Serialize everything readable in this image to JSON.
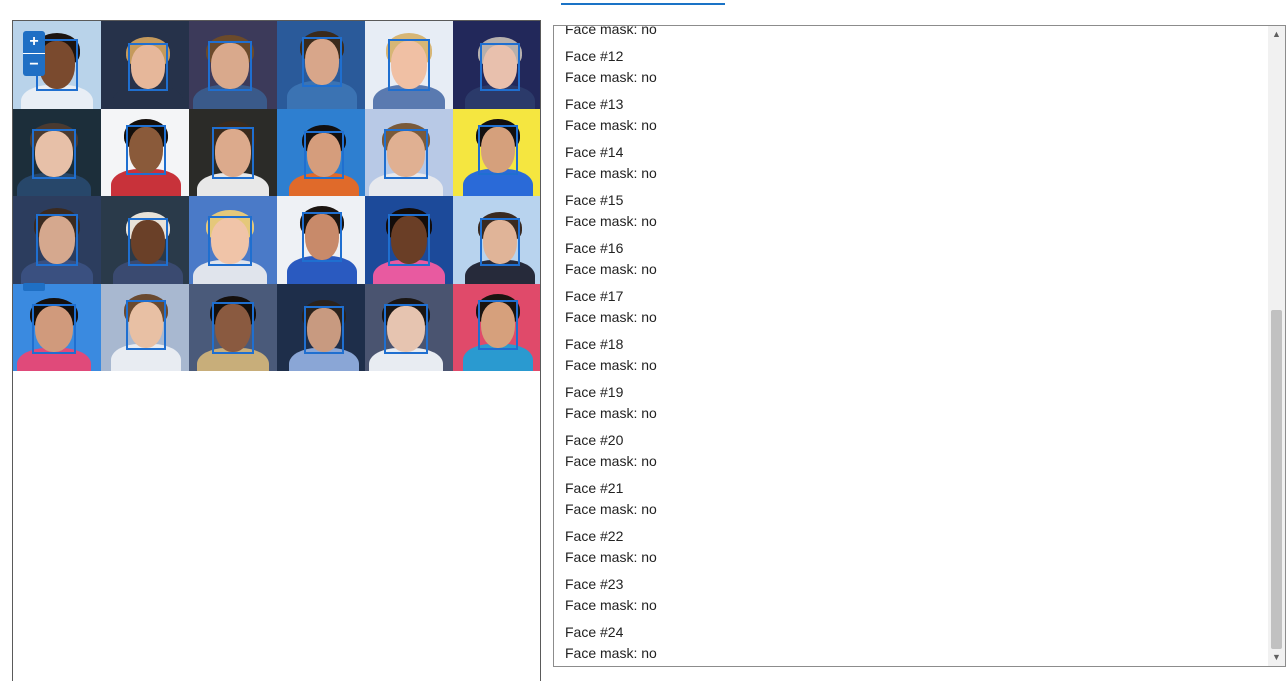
{
  "viewer": {
    "zoom_in_label": "+",
    "zoom_out_label": "−",
    "faces": [
      {
        "bg": "#b9d3ea",
        "hair": "#1d1410",
        "skin": "#7a4a2e",
        "shirt": "#e8eef5"
      },
      {
        "bg": "#26324a",
        "hair": "#c59a5c",
        "skin": "#e6b79a",
        "shirt": "#26324a"
      },
      {
        "bg": "#3c3a5a",
        "hair": "#6b4a2a",
        "skin": "#d9a98c",
        "shirt": "#3a5a8a"
      },
      {
        "bg": "#2a5a9a",
        "hair": "#3a2a1c",
        "skin": "#d8a68a",
        "shirt": "#3b73b3"
      },
      {
        "bg": "#e7edf5",
        "hair": "#d7b675",
        "skin": "#f0c0a4",
        "shirt": "#5a7ab0"
      },
      {
        "bg": "#22285a",
        "hair": "#b7b0ad",
        "skin": "#e8c0ad",
        "shirt": "#2b3a6a"
      },
      {
        "bg": "#1c2e3a",
        "hair": "#4a3a30",
        "skin": "#e7c0a8",
        "shirt": "#27476a"
      },
      {
        "bg": "#f4f5f7",
        "hair": "#140f0c",
        "skin": "#8a5a3a",
        "shirt": "#c8323a"
      },
      {
        "bg": "#2b2b28",
        "hair": "#3a2a1c",
        "skin": "#dcaa8c",
        "shirt": "#e8e8e8"
      },
      {
        "bg": "#2e7fd0",
        "hair": "#120f0f",
        "skin": "#d59d7c",
        "shirt": "#e06a2a"
      },
      {
        "bg": "#b8c9e6",
        "hair": "#7a5a3a",
        "skin": "#e0b092",
        "shirt": "#e7e9ee"
      },
      {
        "bg": "#f5e640",
        "hair": "#120f0f",
        "skin": "#d5a07c",
        "shirt": "#2a6ad8"
      },
      {
        "bg": "#2c3d5e",
        "hair": "#3a2a20",
        "skin": "#d5a88e",
        "shirt": "#3a5080"
      },
      {
        "bg": "#2a3a4a",
        "hair": "#e8e2d8",
        "skin": "#6a4028",
        "shirt": "#3a4a70"
      },
      {
        "bg": "#4a7ac8",
        "hair": "#e5c87a",
        "skin": "#f0c4a8",
        "shirt": "#e0e4ec"
      },
      {
        "bg": "#eef1f5",
        "hair": "#1a1410",
        "skin": "#c88a6a",
        "shirt": "#2a5ac0"
      },
      {
        "bg": "#1c4a9a",
        "hair": "#120c0a",
        "skin": "#6a3e26",
        "shirt": "#e85aa0"
      },
      {
        "bg": "#b8d3ee",
        "hair": "#3a2a20",
        "skin": "#e0b498",
        "shirt": "#262a3a"
      },
      {
        "bg": "#3a8ae0",
        "hair": "#140f0c",
        "skin": "#d09a7c",
        "shirt": "#e04a7a"
      },
      {
        "bg": "#a8b8d0",
        "hair": "#6a4a30",
        "skin": "#e8c0a4",
        "shirt": "#e8ecf2"
      },
      {
        "bg": "#4a5a7a",
        "hair": "#140f0c",
        "skin": "#8a5a40",
        "shirt": "#c8ae7a"
      },
      {
        "bg": "#1e2e4a",
        "hair": "#2a221c",
        "skin": "#c89a80",
        "shirt": "#8aa6d6"
      },
      {
        "bg": "#4a5470",
        "hair": "#1a1614",
        "skin": "#e6c4b0",
        "shirt": "#e8ecf2"
      },
      {
        "bg": "#e04a6a",
        "hair": "#1a1410",
        "skin": "#d6a07c",
        "shirt": "#2a9ad0"
      }
    ]
  },
  "results": {
    "top_partial_label": "Face mask: no",
    "items": [
      {
        "title": "Face #12",
        "mask": "Face mask: no"
      },
      {
        "title": "Face #13",
        "mask": "Face mask: no"
      },
      {
        "title": "Face #14",
        "mask": "Face mask: no"
      },
      {
        "title": "Face #15",
        "mask": "Face mask: no"
      },
      {
        "title": "Face #16",
        "mask": "Face mask: no"
      },
      {
        "title": "Face #17",
        "mask": "Face mask: no"
      },
      {
        "title": "Face #18",
        "mask": "Face mask: no"
      },
      {
        "title": "Face #19",
        "mask": "Face mask: no"
      },
      {
        "title": "Face #20",
        "mask": "Face mask: no"
      },
      {
        "title": "Face #21",
        "mask": "Face mask: no"
      },
      {
        "title": "Face #22",
        "mask": "Face mask: no"
      },
      {
        "title": "Face #23",
        "mask": "Face mask: no"
      },
      {
        "title": "Face #24",
        "mask": "Face mask: no"
      }
    ]
  }
}
